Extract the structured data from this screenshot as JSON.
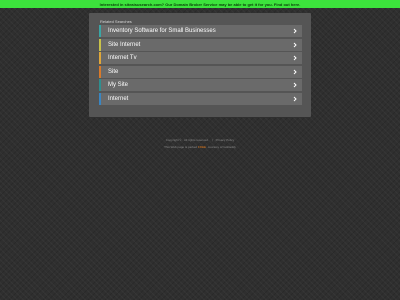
{
  "banner": {
    "text": "Interested in siteaisusearch.com? Our Domain Broker Service may be able to get it for you. Find out here.",
    "color": "#3ce33c"
  },
  "panel": {
    "title": "Related Searches",
    "items": [
      {
        "label": "Inventory Software for Small Businesses",
        "accent": "#3aa6a6",
        "icon": "chevron-right-icon"
      },
      {
        "label": "Site Internet",
        "accent": "#c9c24a",
        "icon": "chevron-right-icon"
      },
      {
        "label": "Internet Tv",
        "accent": "#e0a83a",
        "icon": "chevron-right-icon"
      },
      {
        "label": "Site",
        "accent": "#d97a2a",
        "icon": "chevron-right-icon"
      },
      {
        "label": "My Site",
        "accent": "#2f8f8f",
        "icon": "chevron-right-icon"
      },
      {
        "label": "Internet",
        "accent": "#3a86c2",
        "icon": "chevron-right-icon"
      }
    ]
  },
  "footer": {
    "copyright": "Copyright © . All rights reserved.",
    "separator": "|",
    "privacy": "Privacy Policy",
    "parked_prefix": "This Web page is parked",
    "parked_link": "FREE",
    "parked_suffix": ", courtesy of GoDaddy"
  }
}
